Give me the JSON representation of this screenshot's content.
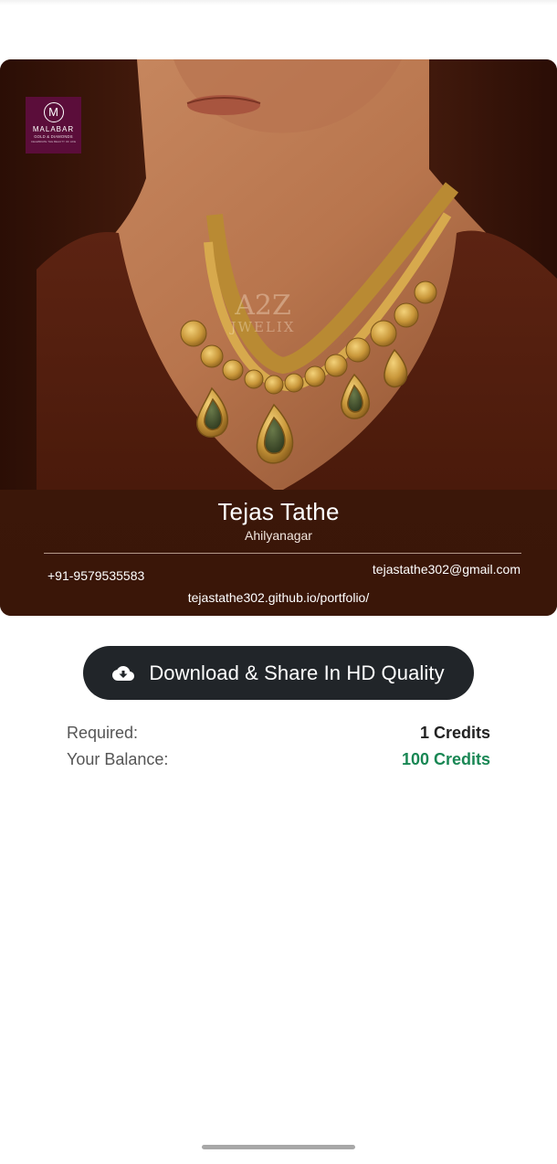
{
  "card": {
    "logo": {
      "icon": "malabar-logo-icon",
      "letter": "M",
      "name": "MALABAR",
      "subtitle": "GOLD & DIAMONDS",
      "tagline": "CELEBRATE THE BEAUTY OF LIFE"
    },
    "watermark": {
      "line1": "A2Z",
      "line2": "JWELIX"
    },
    "person": {
      "name": "Tejas Tathe",
      "city": "Ahilyanagar",
      "phone": "+91-9579535583",
      "email": "tejastathe302@gmail.com",
      "website": "tejastathe302.github.io/portfolio/"
    }
  },
  "download": {
    "icon": "cloud-download-icon",
    "label": "Download & Share In HD Quality"
  },
  "credits": {
    "required_label": "Required:",
    "required_value": "1 Credits",
    "balance_label": "Your Balance:",
    "balance_value": "100 Credits"
  },
  "colors": {
    "button_bg": "#212529",
    "balance_green": "#198754",
    "card_brown": "#3a1709",
    "logo_purple": "#5b0d3a"
  }
}
